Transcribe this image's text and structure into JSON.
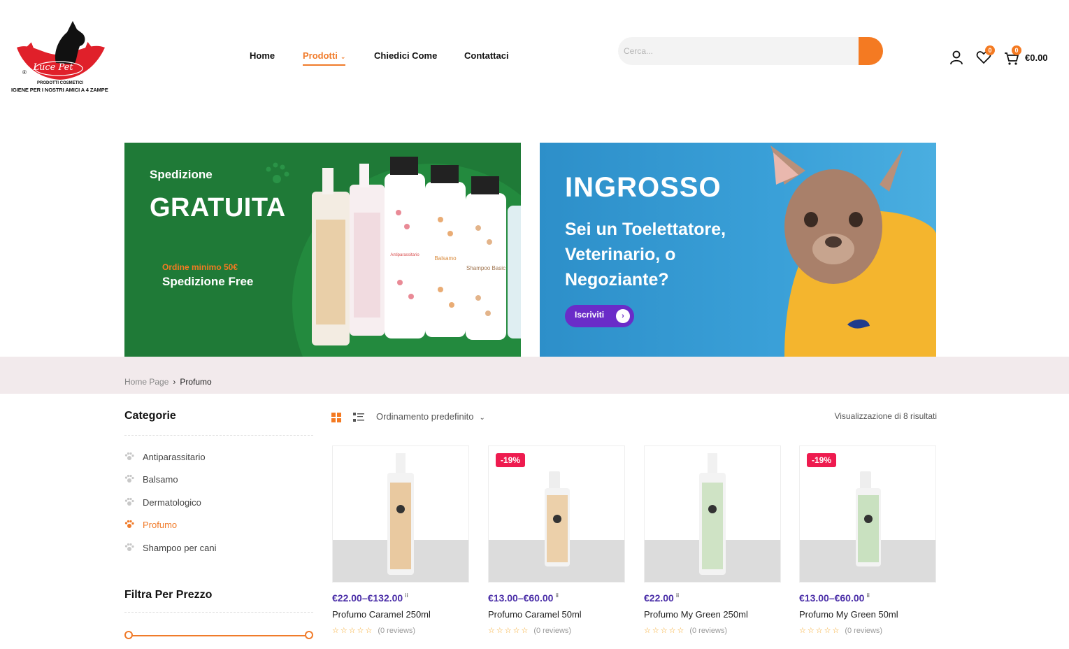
{
  "brand": {
    "logo_text": "Luce Pet",
    "logo_sub": "PRODOTTI COSMETICI",
    "tagline": "IGIENE PER I NOSTRI AMICI A 4 ZAMPE"
  },
  "nav": {
    "items": [
      {
        "label": "Home"
      },
      {
        "label": "Prodotti"
      },
      {
        "label": "Chiedici Come"
      },
      {
        "label": "Contattaci"
      }
    ]
  },
  "search": {
    "placeholder": "Cerca..."
  },
  "header_icons": {
    "wishlist_count": "0",
    "cart_count": "0",
    "cart_total": "€0.00"
  },
  "banner1": {
    "title_small": "Spedizione",
    "title_big": "GRATUITA",
    "min_order": "Ordine minimo 50€",
    "free": "Spedizione Free",
    "bottle_labels": [
      "Antiparassitario",
      "Balsamo",
      "Shampoo Basic"
    ]
  },
  "banner2": {
    "title": "INGROSSO",
    "subtitle": "Sei un Toelettatore, Veterinario, o Negoziante?",
    "button": "Iscriviti"
  },
  "breadcrumb": {
    "home": "Home Page",
    "current": "Profumo"
  },
  "sidebar": {
    "categories_title": "Categorie",
    "categories": [
      {
        "label": "Antiparassitario"
      },
      {
        "label": "Balsamo"
      },
      {
        "label": "Dermatologico"
      },
      {
        "label": "Profumo"
      },
      {
        "label": "Shampoo per cani"
      }
    ],
    "filter_title": "Filtra Per Prezzo"
  },
  "toolbar": {
    "sort_label": "Ordinamento predefinito",
    "results": "Visualizzazione di 8 risultati"
  },
  "products": [
    {
      "name": "Profumo Caramel 250ml",
      "price": "€22.00–€132.00",
      "discount": "",
      "reviews": "(0 reviews)",
      "color": "#e9c9a0"
    },
    {
      "name": "Profumo Caramel 50ml",
      "price": "€13.00–€60.00",
      "discount": "-19%",
      "reviews": "(0 reviews)",
      "color": "#ecd0aa"
    },
    {
      "name": "Profumo My Green 250ml",
      "price": "€22.00",
      "discount": "",
      "reviews": "(0 reviews)",
      "color": "#cfe3c5"
    },
    {
      "name": "Profumo My Green 50ml",
      "price": "€13.00–€60.00",
      "discount": "-19%",
      "reviews": "(0 reviews)",
      "color": "#c9e1c0"
    }
  ],
  "colors": {
    "accent": "#f47a22",
    "price": "#4b2fa8",
    "discount": "#ee1b4f",
    "banner_green": "#1f7a37",
    "banner_blue": "#3aa0d8",
    "cta_purple": "#6a2cc8"
  }
}
